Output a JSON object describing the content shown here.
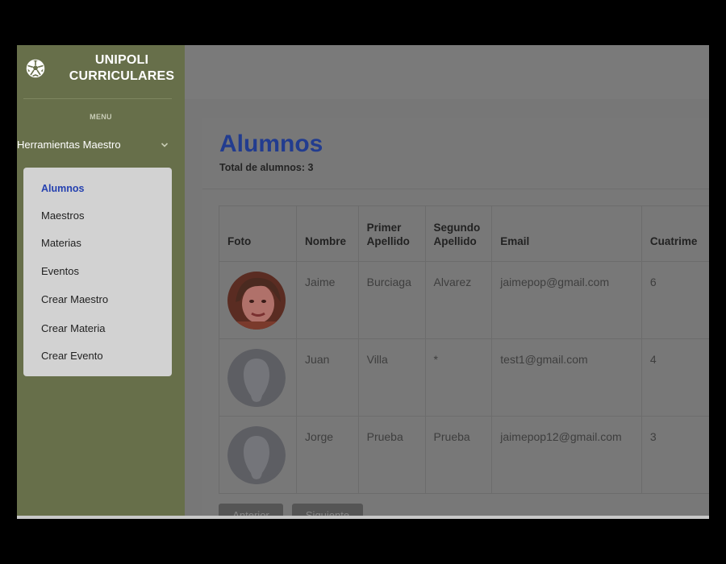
{
  "brand": {
    "line1": "UNIPOLI",
    "line2": "CURRICULARES",
    "logo_icon": "soccer-ball-icon"
  },
  "sidebar": {
    "menu_heading": "MENU",
    "group_label": "Herramientas Maestro",
    "group_icon": "chevron-down-icon",
    "items": [
      {
        "label": "Alumnos",
        "active": true
      },
      {
        "label": "Maestros"
      },
      {
        "label": "Materias"
      },
      {
        "label": "Eventos"
      },
      {
        "label": "Crear Maestro"
      },
      {
        "label": "Crear Materia"
      },
      {
        "label": "Crear Evento"
      }
    ]
  },
  "page": {
    "title": "Alumnos",
    "subtitle": "Total de alumnos: 3"
  },
  "table": {
    "headers": [
      "Foto",
      "Nombre",
      "Primer Apellido",
      "Segundo Apellido",
      "Email",
      "Cuatrime"
    ],
    "rows": [
      {
        "nombre": "Jaime",
        "primer": "Burciaga",
        "segundo": "Alvarez",
        "email": "jaimepop@gmail.com",
        "cuatri": "6",
        "foto": "photo-avatar"
      },
      {
        "nombre": "Juan",
        "primer": "Villa",
        "segundo": "*",
        "email": "test1@gmail.com",
        "cuatri": "4",
        "foto": "placeholder-avatar"
      },
      {
        "nombre": "Jorge",
        "primer": "Prueba",
        "segundo": "Prueba",
        "email": "jaimepop12@gmail.com",
        "cuatri": "3",
        "foto": "placeholder-avatar"
      }
    ]
  },
  "pagination": {
    "prev": "Anterior",
    "next": "Siguiente"
  },
  "colors": {
    "sidebar": "#676f4a",
    "submenu": "#d2d2d2",
    "active_link": "#2541b0",
    "title": "#223c8f"
  }
}
